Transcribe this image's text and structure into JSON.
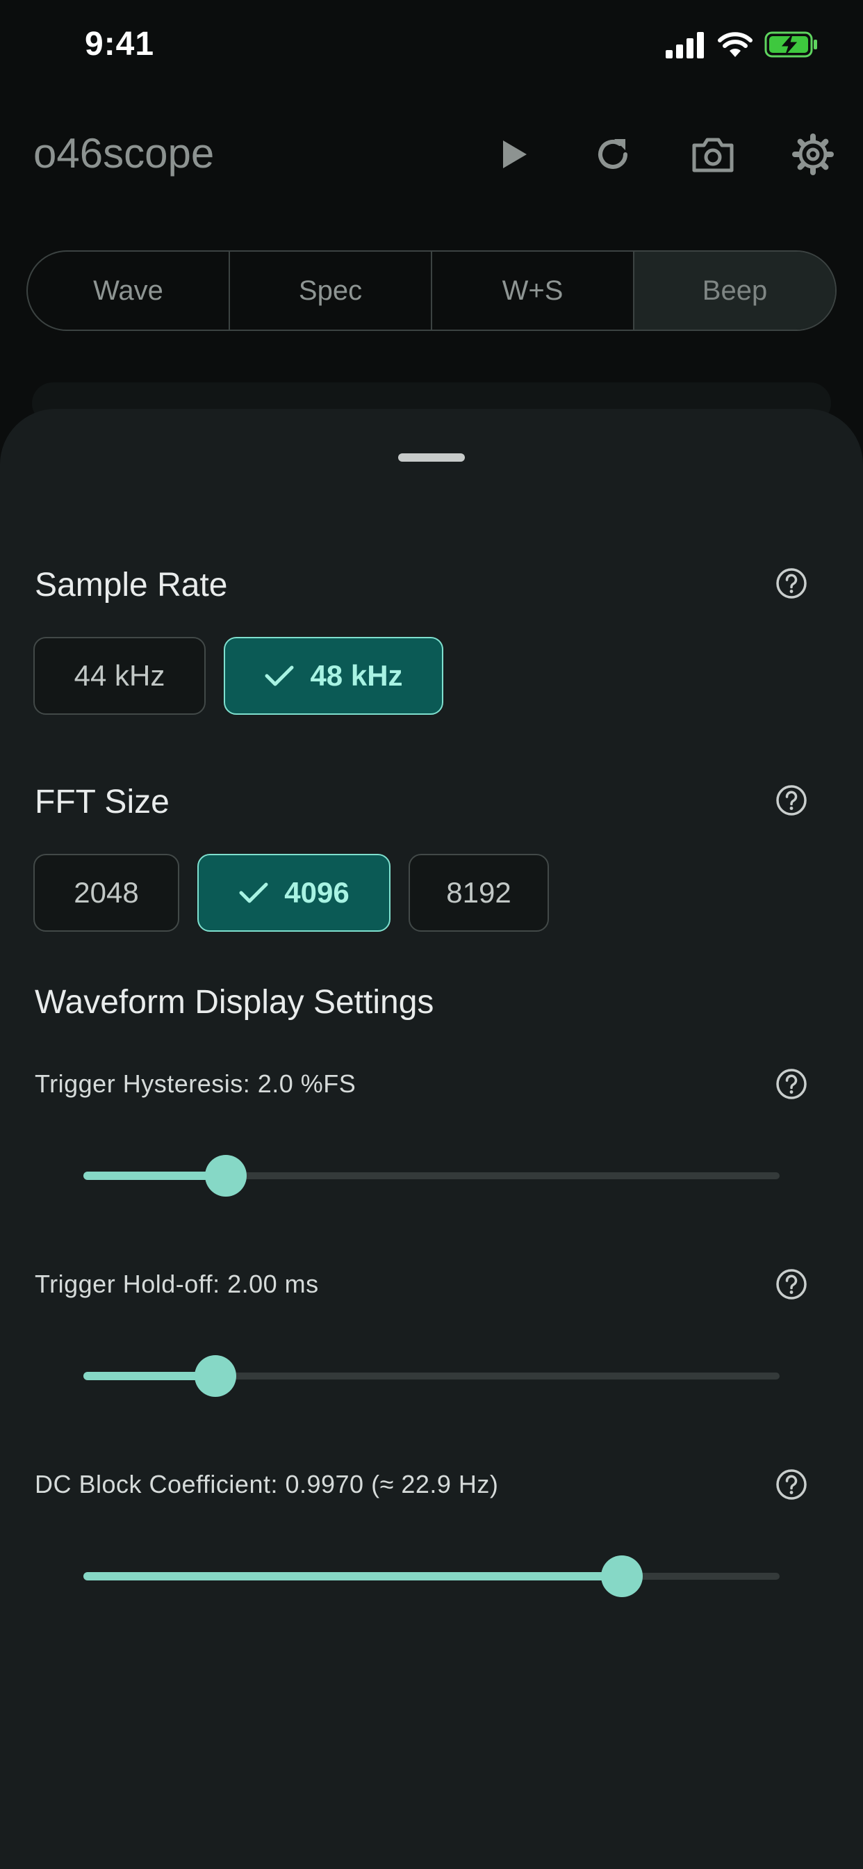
{
  "status": {
    "time": "9:41"
  },
  "app": {
    "title": "o46scope"
  },
  "tabs": [
    "Wave",
    "Spec",
    "W+S",
    "Beep"
  ],
  "sample_rate": {
    "title": "Sample Rate",
    "options": [
      "44 kHz",
      "48 kHz"
    ],
    "selected": "48 kHz"
  },
  "fft_size": {
    "title": "FFT Size",
    "options": [
      "2048",
      "4096",
      "8192"
    ],
    "selected": "4096"
  },
  "waveform": {
    "title": "Waveform Display Settings",
    "sliders": [
      {
        "label": "Trigger Hysteresis: 2.0 %FS",
        "fraction": 0.205
      },
      {
        "label": "Trigger Hold-off: 2.00 ms",
        "fraction": 0.19
      },
      {
        "label": "DC Block Coefficient: 0.9970 (≈ 22.9 Hz)",
        "fraction": 0.773
      }
    ]
  },
  "colors": {
    "accent": "#86d8c6",
    "selected_bg": "#0b5a55",
    "sheet_bg": "#181d1e"
  }
}
